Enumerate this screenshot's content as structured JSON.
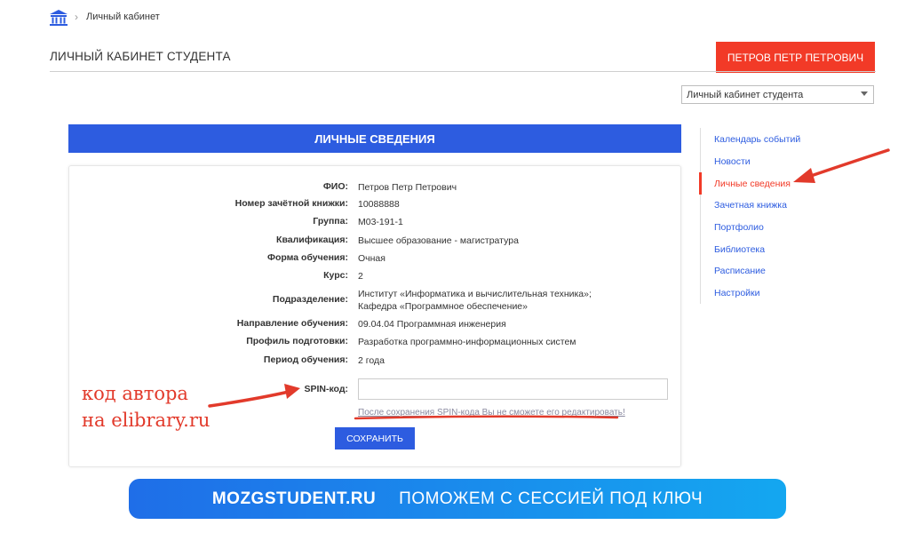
{
  "breadcrumb": {
    "separator": "›",
    "current": "Личный кабинет"
  },
  "header": {
    "title": "ЛИЧНЫЙ КАБИНЕТ СТУДЕНТА",
    "user_name": "ПЕТРОВ ПЕТР ПЕТРОВИЧ"
  },
  "cabinet_select": {
    "value": "Личный кабинет студента"
  },
  "section": {
    "title": "ЛИЧНЫЕ СВЕДЕНИЯ"
  },
  "fields": [
    {
      "label": "ФИО:",
      "value": "Петров Петр Петрович"
    },
    {
      "label": "Номер зачётной книжки:",
      "value": "10088888"
    },
    {
      "label": "Группа:",
      "value": "М03-191-1"
    },
    {
      "label": "Квалификация:",
      "value": "Высшее образование - магистратура"
    },
    {
      "label": "Форма обучения:",
      "value": "Очная"
    },
    {
      "label": "Курс:",
      "value": "2"
    },
    {
      "label": "Подразделение:",
      "value": "Институт «Информатика и вычислительная техника»; Кафедра «Программное обеспечение»"
    },
    {
      "label": "Направление обучения:",
      "value": "09.04.04 Программная инженерия"
    },
    {
      "label": "Профиль подготовки:",
      "value": "Разработка программно-информационных систем"
    },
    {
      "label": "Период обучения:",
      "value": "2 года"
    }
  ],
  "spin": {
    "label": "SPIN-код:",
    "value": "",
    "note": "После сохранения SPIN-кода Вы не сможете его редактировать!",
    "save_label": "СОХРАНИТЬ"
  },
  "sidebar": {
    "items": [
      {
        "label": "Календарь событий",
        "active": false
      },
      {
        "label": "Новости",
        "active": false
      },
      {
        "label": "Личные сведения",
        "active": true
      },
      {
        "label": "Зачетная книжка",
        "active": false
      },
      {
        "label": "Портфолио",
        "active": false
      },
      {
        "label": "Библиотека",
        "active": false
      },
      {
        "label": "Расписание",
        "active": false
      },
      {
        "label": "Настройки",
        "active": false
      }
    ]
  },
  "annotation": {
    "line1": "код автора",
    "line2": "на elibrary.ru"
  },
  "banner": {
    "brand": "MOZGSTUDENT.RU",
    "slogan": "ПОМОЖЕМ С СЕССИЕЙ ПОД КЛЮЧ"
  },
  "colors": {
    "accent_blue": "#2d5ce0",
    "accent_red": "#f23a27",
    "annotation_red": "#e23a2b"
  }
}
